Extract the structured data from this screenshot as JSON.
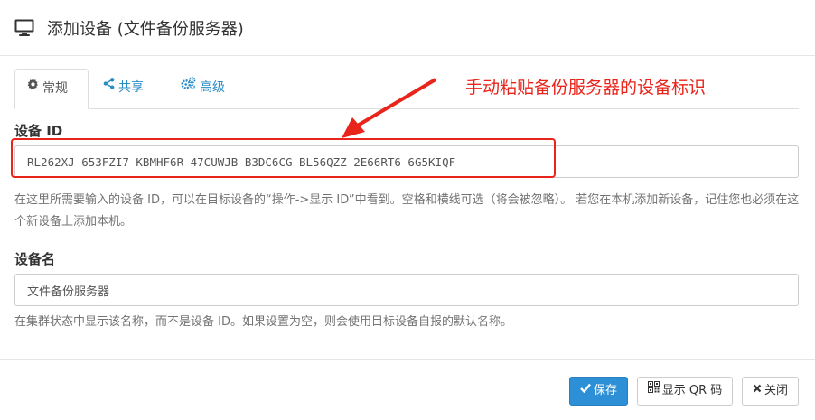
{
  "dialog": {
    "title": "添加设备 (文件备份服务器)",
    "title_icon": "desktop-icon"
  },
  "tabs": [
    {
      "label": "常规",
      "icon": "gear-icon",
      "active": true
    },
    {
      "label": "共享",
      "icon": "share-icon",
      "active": false
    },
    {
      "label": "高级",
      "icon": "cogs-icon",
      "active": false
    }
  ],
  "annotation": {
    "text": "手动粘贴备份服务器的设备标识",
    "color": "#e8241b"
  },
  "device_id": {
    "label": "设备 ID",
    "value": "RL262XJ-653FZI7-KBMHF6R-47CUWJB-B3DC6CG-BL56QZZ-2E66RT6-6G5KIQF",
    "help": "在这里所需要输入的设备 ID，可以在目标设备的“操作->显示 ID”中看到。空格和横线可选（将会被忽略）。 若您在本机添加新设备，记住您也必须在这个新设备上添加本机。"
  },
  "device_name": {
    "label": "设备名",
    "value": "文件备份服务器",
    "help": "在集群状态中显示该名称，而不是设备 ID。如果设置为空，则会使用目标设备自报的默认名称。"
  },
  "footer": {
    "save_label": "保存",
    "qr_label": "显示 QR 码",
    "close_label": "关闭"
  },
  "colors": {
    "primary": "#2d8fd5",
    "link": "#2a8cc7",
    "highlight": "#e8241b"
  }
}
